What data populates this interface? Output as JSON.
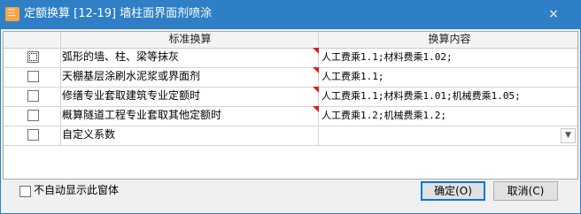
{
  "window": {
    "icon_text": "三",
    "title": "定额换算 [12-19] 墙柱面界面剂喷涂",
    "close_glyph": "×"
  },
  "table": {
    "headers": [
      "",
      "标准换算",
      "换算内容"
    ],
    "rows": [
      {
        "checked": false,
        "name": "弧形的墙、柱、梁等抹灰",
        "content": "人工费乘1.1;材料费乘1.02;",
        "flag": true
      },
      {
        "checked": false,
        "name": "天棚基层涂刷水泥浆或界面剂",
        "content": "人工费乘1.1;",
        "flag": true
      },
      {
        "checked": false,
        "name": "修缮专业套取建筑专业定额时",
        "content": "人工费乘1.1;材料费乘1.01;机械费乘1.05;",
        "flag": true
      },
      {
        "checked": false,
        "name": "概算隧道工程专业套取其他定额时",
        "content": "人工费乘1.2;机械费乘1.2;",
        "flag": true
      },
      {
        "checked": false,
        "name": "自定义系数",
        "content": "",
        "flag": false,
        "dropdown": true
      }
    ]
  },
  "footer": {
    "auto_hide_label": "不自动显示此窗体",
    "auto_hide_checked": false,
    "ok_label": "确定(O)",
    "cancel_label": "取消(C)"
  },
  "colors": {
    "titlebar": "#2f7fc6",
    "flag": "#e21c1c"
  }
}
